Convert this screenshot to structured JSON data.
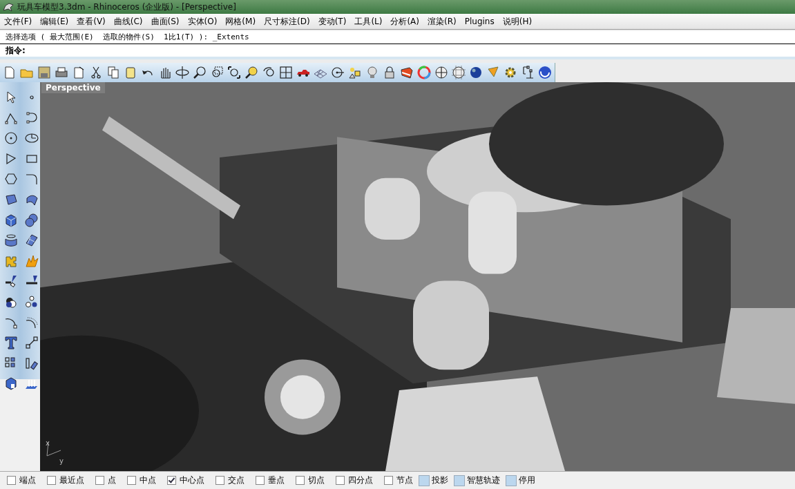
{
  "window": {
    "title": "玩具车模型3.3dm - Rhinoceros (企业版) - [Perspective]"
  },
  "menu": [
    "文件(F)",
    "编辑(E)",
    "查看(V)",
    "曲线(C)",
    "曲面(S)",
    "实体(O)",
    "网格(M)",
    "尺寸标注(D)",
    "变动(T)",
    "工具(L)",
    "分析(A)",
    "渲染(R)",
    "Plugins",
    "说明(H)"
  ],
  "command": {
    "history": "选择选项 ( 最大范围(E)  选取的物件(S)  1比1(T) ): _Extents",
    "prompt": "指令:"
  },
  "viewport": {
    "label": "Perspective",
    "kind": "picture",
    "axis_labels": [
      "x",
      "y"
    ]
  },
  "osnaps": [
    {
      "label": "端点",
      "checked": false,
      "kind": "checkbox"
    },
    {
      "label": "最近点",
      "checked": false,
      "kind": "checkbox"
    },
    {
      "label": "点",
      "checked": false,
      "kind": "checkbox"
    },
    {
      "label": "中点",
      "checked": false,
      "kind": "checkbox"
    },
    {
      "label": "中心点",
      "checked": true,
      "kind": "checkbox"
    },
    {
      "label": "交点",
      "checked": false,
      "kind": "checkbox"
    },
    {
      "label": "垂点",
      "checked": false,
      "kind": "checkbox"
    },
    {
      "label": "切点",
      "checked": false,
      "kind": "checkbox"
    },
    {
      "label": "四分点",
      "checked": false,
      "kind": "checkbox"
    },
    {
      "label": "节点",
      "checked": false,
      "kind": "checkbox"
    },
    {
      "label": "投影",
      "checked": false,
      "kind": "toggle"
    },
    {
      "label": "智慧轨迹",
      "checked": false,
      "kind": "toggle"
    },
    {
      "label": "停用",
      "checked": false,
      "kind": "toggle"
    }
  ]
}
